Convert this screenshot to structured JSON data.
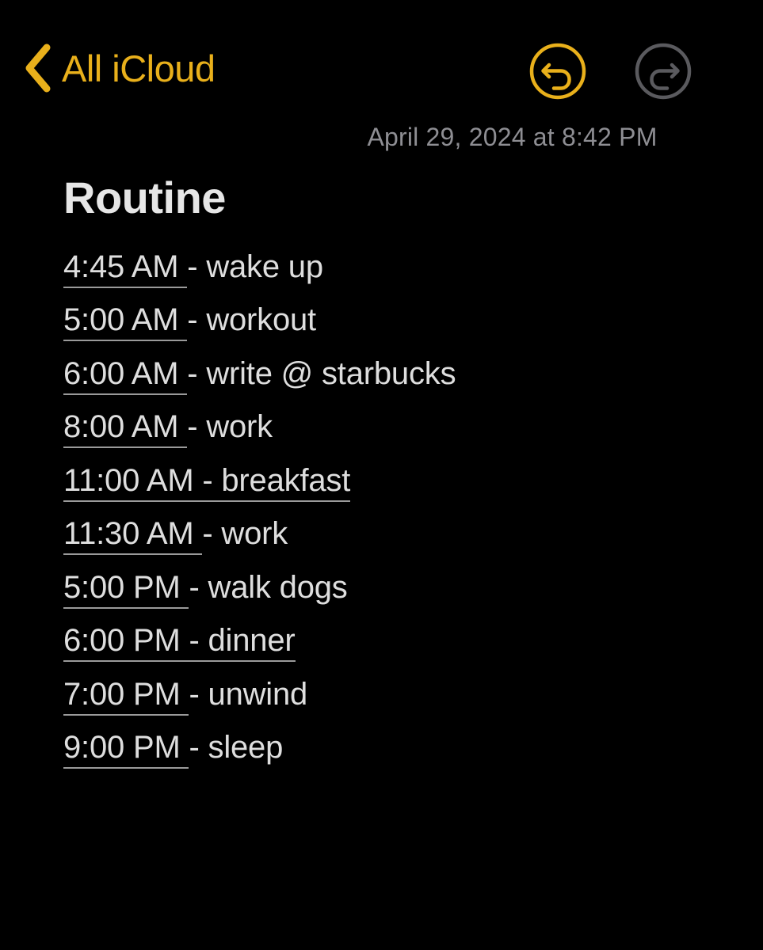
{
  "app": {
    "background_color": "#000000",
    "accent_color": "#e9b01b",
    "text_color": "#dedede",
    "muted_color": "#8e8e93"
  },
  "navbar": {
    "back_label": "All iCloud",
    "back_icon": "chevron-left-icon",
    "undo": {
      "icon": "undo-circle-icon",
      "enabled": true,
      "color": "#e9b01b"
    },
    "redo": {
      "icon": "redo-circle-icon",
      "enabled": false,
      "color": "#5a5a5e"
    }
  },
  "note": {
    "date": "April 29, 2024 at 8:42 PM",
    "title": "Routine",
    "items": [
      {
        "time": "4:45 AM",
        "separator": " - ",
        "activity": "wake up",
        "underline": "time"
      },
      {
        "time": "5:00 AM",
        "separator": " - ",
        "activity": "workout",
        "underline": "time"
      },
      {
        "time": "6:00 AM",
        "separator": " - ",
        "activity": "write @ starbucks",
        "underline": "time"
      },
      {
        "time": "8:00 AM",
        "separator": " - ",
        "activity": "work",
        "underline": "time"
      },
      {
        "time": "11:00 AM",
        "separator": " - ",
        "activity": "breakfast",
        "underline": "all"
      },
      {
        "time": "11:30 AM",
        "separator": " - ",
        "activity": "work",
        "underline": "time"
      },
      {
        "time": "5:00 PM",
        "separator": " - ",
        "activity": "walk dogs",
        "underline": "time"
      },
      {
        "time": "6:00 PM",
        "separator": " - ",
        "activity": "dinner",
        "underline": "all"
      },
      {
        "time": "7:00 PM",
        "separator": " - ",
        "activity": "unwind",
        "underline": "time"
      },
      {
        "time": "9:00 PM",
        "separator": " - ",
        "activity": "sleep",
        "underline": "time"
      }
    ]
  }
}
